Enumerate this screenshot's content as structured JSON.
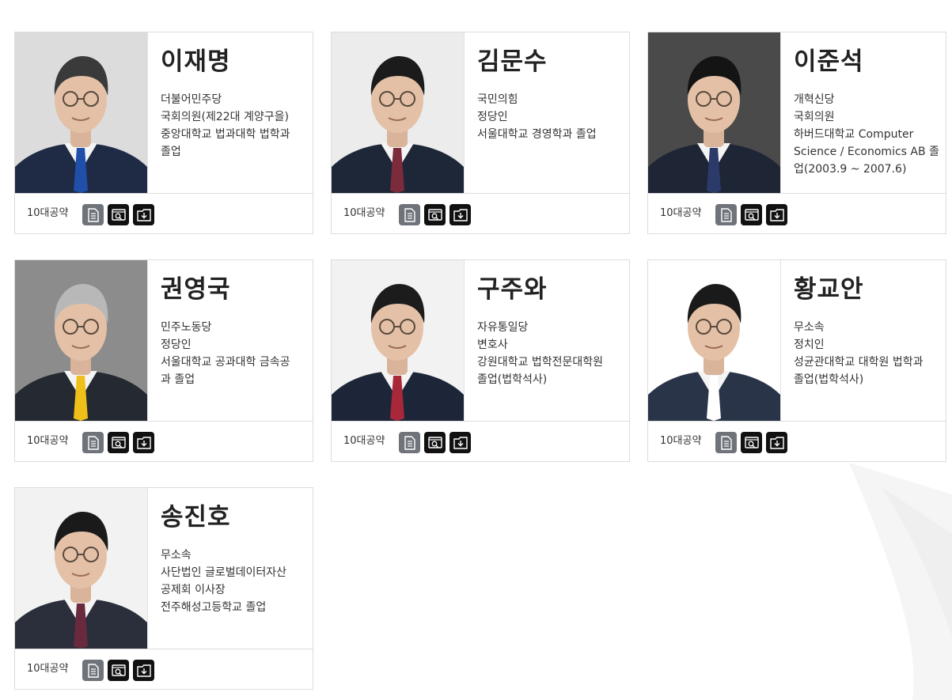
{
  "pledge_label": "10대공약",
  "candidates": [
    {
      "name": "이재명",
      "lines": [
        "더불어민주당",
        "국회의원(제22대 계양구을)",
        "중앙대학교 법과대학 법학과",
        "졸업"
      ],
      "photo": {
        "bg": "#dcdcdc",
        "suit": "#1f2a44",
        "tie": "#1f4fa8",
        "hair": "#3a3a3a"
      }
    },
    {
      "name": "김문수",
      "lines": [
        "국민의힘",
        "정당인",
        "서울대학교 경영학과 졸업"
      ],
      "photo": {
        "bg": "#ececec",
        "suit": "#1e2738",
        "tie": "#7b2b3c",
        "hair": "#1b1b1b"
      }
    },
    {
      "name": "이준석",
      "lines": [
        "개혁신당",
        "국회의원",
        "하버드대학교 Computer",
        "Science / Economics AB 졸",
        "업(2003.9 ~ 2007.6)"
      ],
      "photo": {
        "bg": "#4a4a4a",
        "suit": "#1e2535",
        "tie": "#2c3a6a",
        "hair": "#141414"
      }
    },
    {
      "name": "권영국",
      "lines": [
        "민주노동당",
        "정당인",
        "서울대학교 공과대학 금속공",
        "과 졸업"
      ],
      "photo": {
        "bg": "#8c8c8c",
        "suit": "#252a32",
        "tie": "#f0c01a",
        "hair": "#b8b8b8"
      }
    },
    {
      "name": "구주와",
      "lines": [
        "자유통일당",
        "변호사",
        "강원대학교 법학전문대학원",
        "졸업(법학석사)"
      ],
      "photo": {
        "bg": "#f2f2f2",
        "suit": "#1d2638",
        "tie": "#a8283a",
        "hair": "#1c1c1c"
      }
    },
    {
      "name": "황교안",
      "lines": [
        "무소속",
        "정치인",
        "성균관대학교 대학원 법학과",
        "졸업(법학석사)"
      ],
      "photo": {
        "bg": "#ffffff",
        "suit": "#2a3448",
        "tie": "#ffffff",
        "hair": "#1a1a1a"
      }
    },
    {
      "name": "송진호",
      "lines": [
        "무소속",
        "사단법인 글로벌데이터자산",
        "공제회 이사장",
        "전주해성고등학교 졸업"
      ],
      "photo": {
        "bg": "#f2f2f2",
        "suit": "#2a2f3b",
        "tie": "#6a2a3e",
        "hair": "#1a1a1a"
      }
    }
  ],
  "icons": {
    "document": "document-icon",
    "view": "search-view-icon",
    "download": "download-icon"
  },
  "colors": {
    "card_border": "#dcdcdc",
    "btn_doc": "#6f737a",
    "btn_dark": "#111111"
  }
}
